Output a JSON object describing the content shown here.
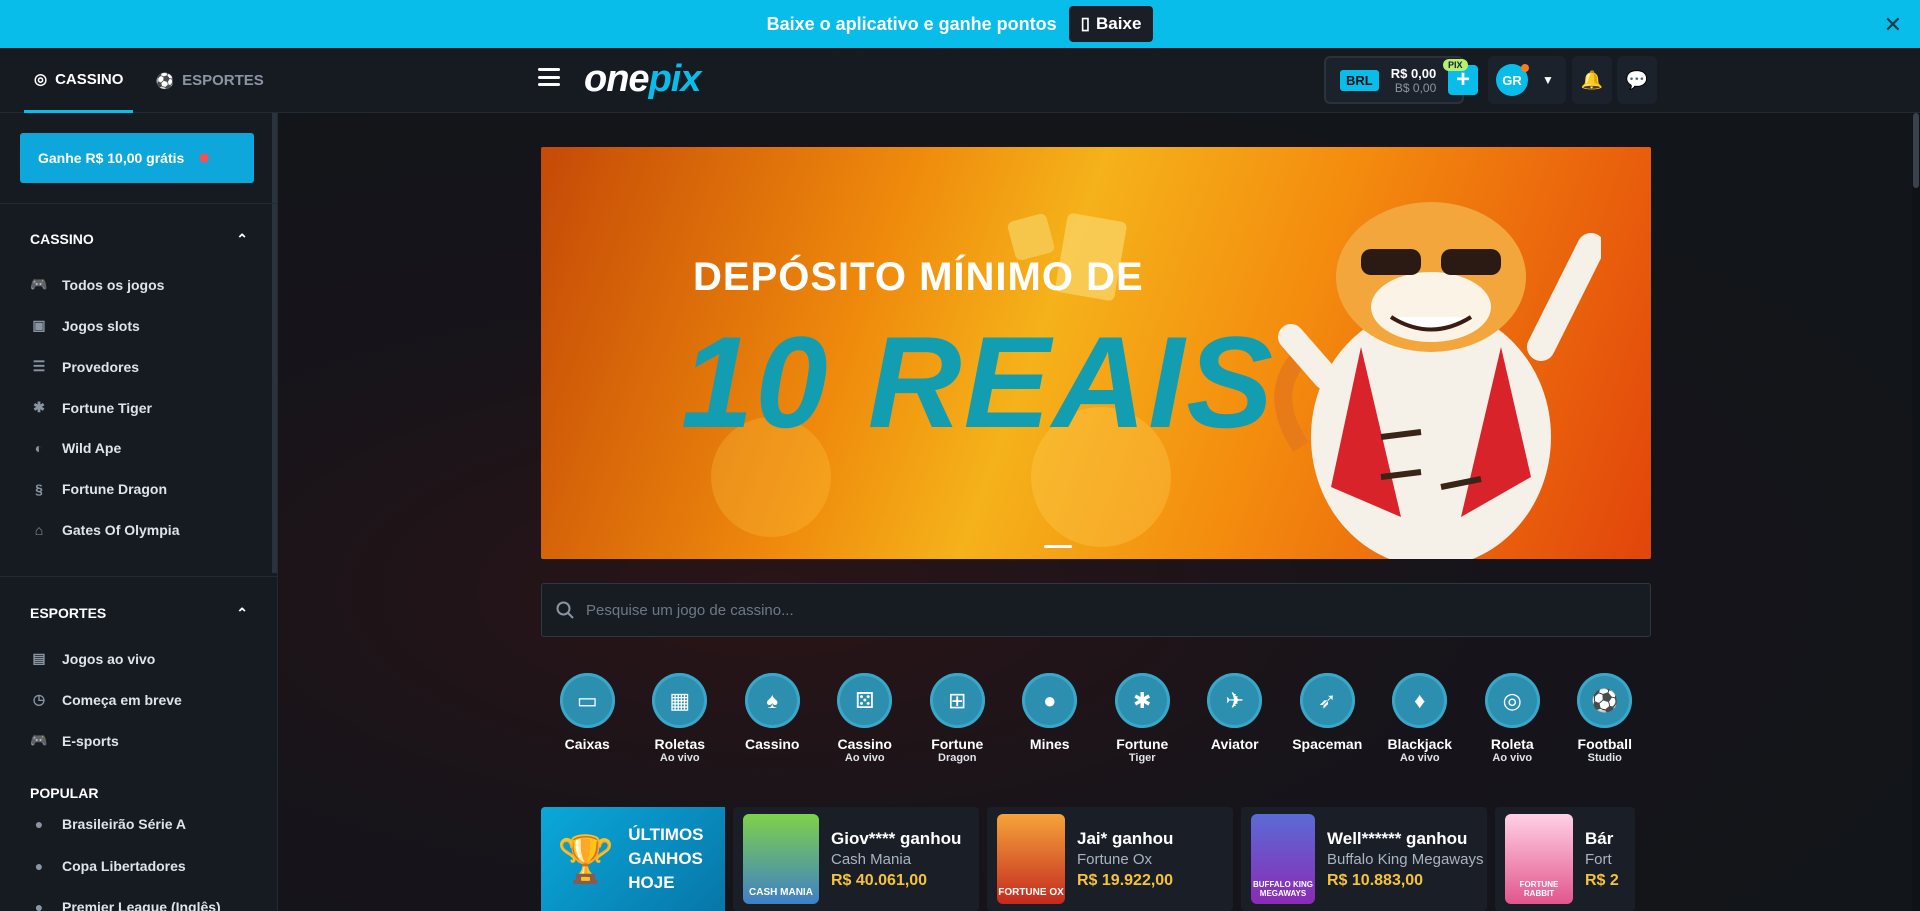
{
  "topbar": {
    "message": "Baixe o aplicativo e ganhe pontos",
    "download_label": "Baixe",
    "close": "✕"
  },
  "header": {
    "tabs": [
      {
        "label": "CASSINO"
      },
      {
        "label": "ESPORTES"
      }
    ],
    "logo_a": "one",
    "logo_b": "pix",
    "wallet": {
      "currency": "BRL",
      "balance": "R$ 0,00",
      "bonus": "B$ 0,00",
      "pix_badge": "PIX"
    },
    "avatar_initials": "GR"
  },
  "sidebar": {
    "promo": "Ganhe R$ 10,00 grátis",
    "casino_title": "CASSINO",
    "casino_items": [
      "Todos os jogos",
      "Jogos slots",
      "Provedores",
      "Fortune Tiger",
      "Wild Ape",
      "Fortune Dragon",
      "Gates Of Olympia"
    ],
    "sports_title": "ESPORTES",
    "sports_items": [
      "Jogos ao vivo",
      "Começa em breve",
      "E-sports"
    ],
    "popular_title": "POPULAR",
    "popular_items": [
      "Brasileirão Série A",
      "Copa Libertadores",
      "Premier League (Inglês)"
    ]
  },
  "banner": {
    "line1": "DEPÓSITO MÍNIMO DE",
    "line2": "10 REAIS"
  },
  "search": {
    "placeholder": "Pesquise um jogo de cassino..."
  },
  "categories": [
    {
      "label": "Caixas",
      "sub": "",
      "icon": "box-icon"
    },
    {
      "label": "Roletas",
      "sub": "Ao vivo",
      "icon": "film-icon"
    },
    {
      "label": "Cassino",
      "sub": "",
      "icon": "cards-icon"
    },
    {
      "label": "Cassino",
      "sub": "Ao vivo",
      "icon": "dice-icon"
    },
    {
      "label": "Fortune",
      "sub": "Dragon",
      "icon": "gamepad-icon"
    },
    {
      "label": "Mines",
      "sub": "",
      "icon": "bomb-icon"
    },
    {
      "label": "Fortune",
      "sub": "Tiger",
      "icon": "paw-icon"
    },
    {
      "label": "Aviator",
      "sub": "",
      "icon": "plane-icon"
    },
    {
      "label": "Spaceman",
      "sub": "",
      "icon": "rocket-icon"
    },
    {
      "label": "Blackjack",
      "sub": "Ao vivo",
      "icon": "card-icon"
    },
    {
      "label": "Roleta",
      "sub": "Ao vivo",
      "icon": "roulette-icon"
    },
    {
      "label": "Football",
      "sub": "Studio",
      "icon": "ball-icon"
    }
  ],
  "winners": {
    "title_lines": [
      "ÚLTIMOS",
      "GANHOS",
      "HOJE"
    ],
    "cards": [
      {
        "name": "Giov**** ganhou",
        "game": "Cash Mania",
        "amount": "R$ 40.061,00",
        "thumb": "CASH MANIA"
      },
      {
        "name": "Jai* ganhou",
        "game": "Fortune Ox",
        "amount": "R$ 19.922,00",
        "thumb": "FORTUNE OX"
      },
      {
        "name": "Well****** ganhou",
        "game": "Buffalo King Megaways",
        "amount": "R$ 10.883,00",
        "thumb": "BUFFALO KING MEGAWAYS"
      },
      {
        "name": "Bár",
        "game": "Fort",
        "amount": "R$ 2",
        "thumb": "FORTUNE RABBIT"
      }
    ]
  }
}
